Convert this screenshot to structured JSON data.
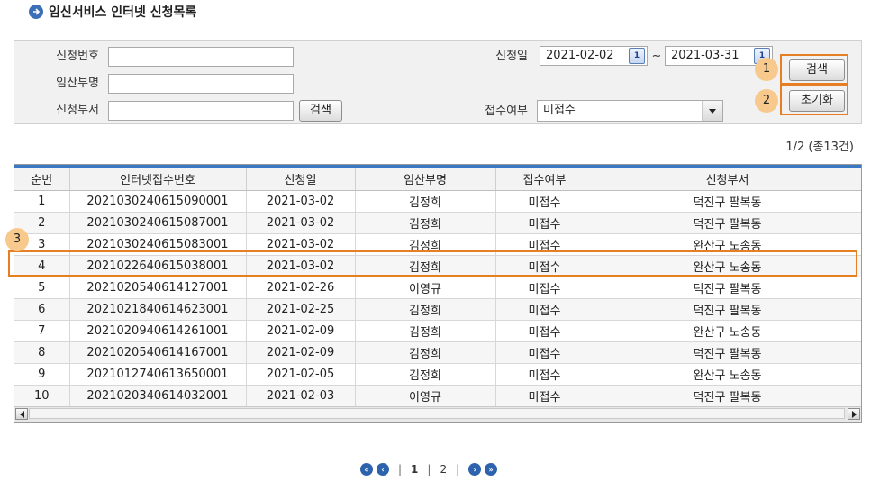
{
  "header": {
    "title": "임신서비스 인터넷 신청목록"
  },
  "search": {
    "application_no_label": "신청번호",
    "application_no_value": "",
    "mother_name_label": "임산부명",
    "mother_name_value": "",
    "dept_label": "신청부서",
    "dept_value": "",
    "dept_search_button": "검색",
    "date_label": "신청일",
    "date_from": "2021-02-02",
    "date_sep": "~",
    "date_to": "2021-03-31",
    "calendar_icon_text": "1",
    "receipt_label": "접수여부",
    "receipt_value": "미접수",
    "search_button": "검색",
    "reset_button": "초기화"
  },
  "markers": [
    "1",
    "2",
    "3"
  ],
  "colors": {
    "highlight": "#e67e22",
    "marker_bg": "#f7c98c",
    "header_bar": "#3b78c4",
    "pager_icon": "#2d63ad"
  },
  "result_count": "1/2 (총13건)",
  "table": {
    "headers": [
      "순번",
      "인터넷접수번호",
      "신청일",
      "임산부명",
      "접수여부",
      "신청부서"
    ],
    "rows": [
      [
        "1",
        "2021030240615090001",
        "2021-03-02",
        "김정희",
        "미접수",
        "덕진구 팔복동"
      ],
      [
        "2",
        "2021030240615087001",
        "2021-03-02",
        "김정희",
        "미접수",
        "덕진구 팔복동"
      ],
      [
        "3",
        "2021030240615083001",
        "2021-03-02",
        "김정희",
        "미접수",
        "완산구 노송동"
      ],
      [
        "4",
        "2021022640615038001",
        "2021-03-02",
        "김정희",
        "미접수",
        "완산구 노송동"
      ],
      [
        "5",
        "2021020540614127001",
        "2021-02-26",
        "이영규",
        "미접수",
        "덕진구 팔복동"
      ],
      [
        "6",
        "2021021840614623001",
        "2021-02-25",
        "김정희",
        "미접수",
        "덕진구 팔복동"
      ],
      [
        "7",
        "2021020940614261001",
        "2021-02-09",
        "김정희",
        "미접수",
        "완산구 노송동"
      ],
      [
        "8",
        "2021020540614167001",
        "2021-02-09",
        "김정희",
        "미접수",
        "덕진구 팔복동"
      ],
      [
        "9",
        "2021012740613650001",
        "2021-02-05",
        "김정희",
        "미접수",
        "완산구 노송동"
      ],
      [
        "10",
        "2021020340614032001",
        "2021-02-03",
        "이영규",
        "미접수",
        "덕진구 팔복동"
      ]
    ]
  },
  "pager": {
    "page1": "1",
    "page2": "2",
    "separator": "|"
  }
}
